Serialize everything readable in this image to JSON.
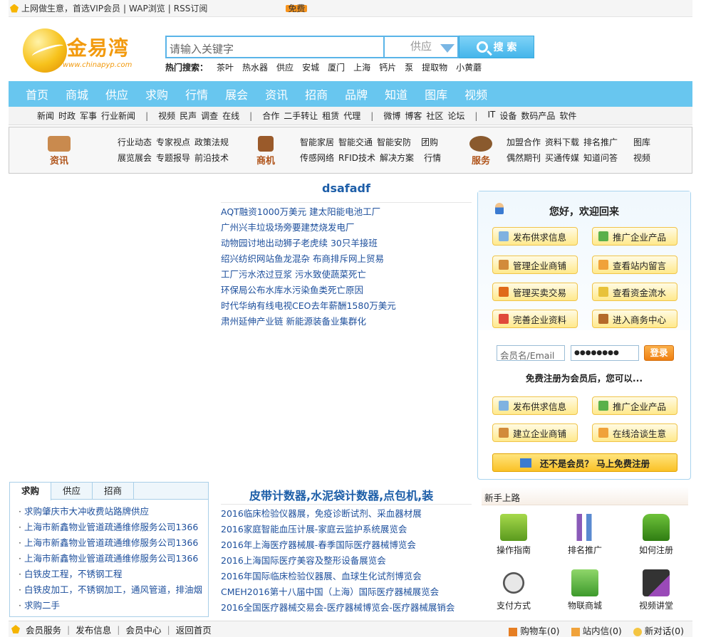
{
  "topbar": {
    "links": [
      "上网做生意，首选VIP会员",
      "WAP浏览",
      "RSS订阅"
    ],
    "badge": "免费"
  },
  "logo": {
    "name": "金易湾",
    "url": "www.chinapyp.com"
  },
  "search": {
    "placeholder": "请输入关键字",
    "type": "供应",
    "button": "搜 索"
  },
  "hot": {
    "label": "热门搜索：",
    "terms": [
      "茶叶",
      "热水器",
      "供应",
      "安城",
      "厦门",
      "上海",
      "钙片",
      "泵",
      "提取物",
      "小黄蘑"
    ]
  },
  "mainnav": [
    "首页",
    "商城",
    "供应",
    "求购",
    "行情",
    "展会",
    "资讯",
    "招商",
    "品牌",
    "知道",
    "图库",
    "视频"
  ],
  "subnav": [
    [
      "新闻",
      "时政",
      "军事",
      "行业新闻"
    ],
    [
      "视频",
      "民声",
      "调查",
      "在线"
    ],
    [
      "合作",
      "二手转让",
      "租赁",
      "代理"
    ],
    [
      "微博",
      "博客",
      "社区",
      "论坛"
    ],
    [
      "IT",
      "设备",
      "数码产品",
      "软件"
    ]
  ],
  "cat": {
    "zixun": {
      "label": "资讯",
      "rows": [
        [
          "行业动态",
          "专家视点",
          "政策法规"
        ],
        [
          "展览展会",
          "专题报导",
          "前沿技术"
        ]
      ]
    },
    "shangji": {
      "label": "商机",
      "rows": [
        [
          "智能家居",
          "智能交通",
          "智能安防",
          "团购"
        ],
        [
          "传感网络",
          "RFID技术",
          "解决方案",
          "行情"
        ]
      ]
    },
    "fuwu": {
      "label": "服务",
      "rows": [
        [
          "加盟合作",
          "资料下载",
          "排名推广",
          "图库"
        ],
        [
          "偶然期刊",
          "买通传媒",
          "知道问答",
          "视频"
        ]
      ]
    }
  },
  "news1": {
    "title": "dsafadf",
    "items": [
      "AQT融资1000万美元  建太阳能电池工厂",
      "广州兴丰垃圾场旁要建焚烧发电厂",
      "动物园讨地出动狮子老虎续  30只羊接班",
      "绍兴纺织网站鱼龙混杂  布商排斥网上贸易",
      "工厂污水浓过豆浆  污水致使蔬菜死亡",
      "环保局公布水库水污染鱼类死亡原因",
      "时代华纳有线电视CEO去年薪酬1580万美元",
      "肃州延伸产业链  新能源装备业集群化"
    ]
  },
  "user": {
    "greeting": "您好，欢迎回来",
    "buttons": [
      "发布供求信息",
      "推广企业产品",
      "管理企业商铺",
      "查看站内留言",
      "管理买卖交易",
      "查看资金流水",
      "完善企业资料",
      "进入商务中心"
    ],
    "username_ph": "会员名/Email",
    "password": "●●●●●●●●",
    "login": "登录",
    "free_note": "免费注册为会员后，您可以...",
    "buttons2": [
      "发布供求信息",
      "推广企业产品",
      "建立企业商铺",
      "在线洽谈生意"
    ],
    "register": "还不是会员？  马上免费注册"
  },
  "tabs": {
    "labels": [
      "求购",
      "供应",
      "招商"
    ],
    "items": [
      "求购肇庆市大冲收费站路牌供应",
      "上海市新鑫物业管道疏通维修服务公司1366",
      "上海市新鑫物业管道疏通维修服务公司1366",
      "上海市新鑫物业管道疏通维修服务公司1366",
      "白铁皮工程，不锈钢工程",
      "白铁皮加工，不锈钢加工，通风管道，排油烟",
      "求购二手"
    ]
  },
  "news2": {
    "title": "皮带计数器,水泥袋计数器,点包机,装",
    "items": [
      "2016临床检验仪器展，免疫诊断试剂、采血器材展",
      "2016家庭智能血压计展-家庭云监护系统展览会",
      "2016年上海医疗器械展-春季国际医疗器械博览会",
      "2016上海国际医疗美容及整形设备展览会",
      "2016年国际临床检验仪器展、血球生化试剂博览会",
      "CMEH2016第十八届中国（上海）国际医疗器械展览会",
      "2016全国医疗器械交易会-医疗器械博览会-医疗器械展销会"
    ]
  },
  "novice": {
    "title": "新手上路",
    "items": [
      "操作指南",
      "排名推广",
      "如何注册",
      "支付方式",
      "物联商城",
      "视频讲堂"
    ]
  },
  "bottom": {
    "left": [
      "会员服务",
      "发布信息",
      "会员中心",
      "返回首页"
    ],
    "cart": "购物车(0)",
    "mail": "站内信(0)",
    "chat": "新对话(0)"
  },
  "colors": {
    "nav": "#68c6ef",
    "link": "#1d4f9c",
    "orange": "#f29a0e"
  }
}
